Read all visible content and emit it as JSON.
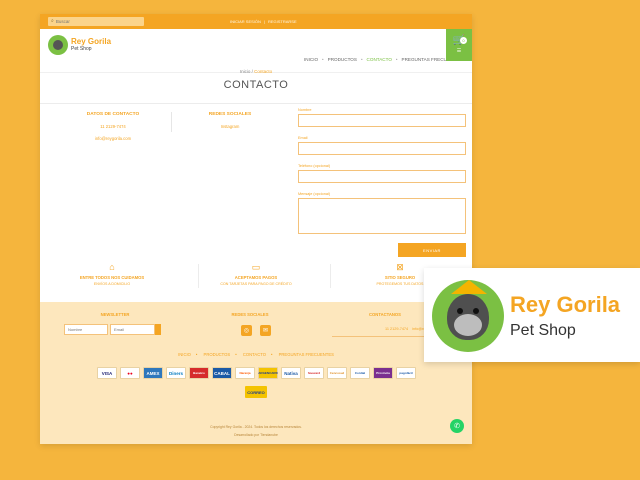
{
  "topbar": {
    "search_placeholder": "Buscar",
    "links": [
      "INICIAR SESIÓN",
      "|",
      "REGISTRARSE"
    ]
  },
  "header": {
    "brand": "Rey Gorila",
    "subtitle": "Pet Shop",
    "nav": [
      {
        "label": "INICIO",
        "active": false
      },
      {
        "label": "PRODUCTOS",
        "active": false
      },
      {
        "label": "CONTACTO",
        "active": true
      },
      {
        "label": "PREGUNTAS FRECUENTES",
        "active": false
      }
    ],
    "cart_count": "0",
    "cart_menu": "☰"
  },
  "breadcrumb": {
    "home": "Inicio",
    "sep": " / ",
    "current": "Contacto"
  },
  "title": "CONTACTO",
  "contact_info": {
    "heading": "DATOS DE CONTACTO",
    "phone": "11 2129-7474",
    "email": "info@reygorila.com"
  },
  "social_info": {
    "heading": "REDES SOCIALES",
    "link": "Instagram"
  },
  "form": {
    "name_label": "Nombre",
    "email_label": "Email",
    "phone_label": "Teléfono (opcional)",
    "message_label": "Mensaje (opcional)",
    "submit": "ENVIAR"
  },
  "features": [
    {
      "icon": "house-icon",
      "title": "ENTRE TODOS NOS CUIDAMOS",
      "sub": "ENVÍOS A DOMICILIO"
    },
    {
      "icon": "card-icon",
      "title": "ACEPTAMOS PAGOS",
      "sub": "CON TARJETAS PARA PAGO DE CRÉDITO"
    },
    {
      "icon": "lock-icon",
      "title": "SITIO SEGURO",
      "sub": "PROTEGEMOS TUS DATOS"
    }
  ],
  "footer": {
    "newsletter_heading": "NEWSLETTER",
    "newsletter_name_placeholder": "Nombre",
    "newsletter_email_placeholder": "Email",
    "social_heading": "REDES SOCIALES",
    "contact_heading": "CONTACTANOS",
    "contact_phone": "11 2129-7474",
    "contact_email": "info@reygorila.com",
    "nav": [
      "INICIO",
      "PRODUCTOS",
      "CONTACTO",
      "PREGUNTAS FRECUENTES"
    ],
    "payments_row1": [
      {
        "label": "VISA",
        "color": "#ffffff",
        "text": "#1a1f71"
      },
      {
        "label": "●●",
        "color": "#ffffff",
        "text": "#eb001b"
      },
      {
        "label": "AMEX",
        "color": "#2e77bc",
        "text": "#ffffff"
      },
      {
        "label": "Diners",
        "color": "#ffffff",
        "text": "#0079be"
      },
      {
        "label": "Banelco",
        "color": "#d62b2b",
        "text": "#ffffff"
      },
      {
        "label": "CABAL",
        "color": "#1b5aa6",
        "text": "#ffffff"
      },
      {
        "label": "Naranja",
        "color": "#ffffff",
        "text": "#ff5a00"
      },
      {
        "label": "ARGENCARD",
        "color": "#f4c300",
        "text": "#1b3b8f"
      },
      {
        "label": "Nativa",
        "color": "#ffffff",
        "text": "#1b5aa6"
      },
      {
        "label": "favacard",
        "color": "#ffffff",
        "text": "#d62b2b"
      },
      {
        "label": "Cencosud",
        "color": "#ffffff",
        "text": "#e0922b"
      },
      {
        "label": "Cordial",
        "color": "#ffffff",
        "text": "#1b5aa6"
      },
      {
        "label": "Provincia",
        "color": "#7a2f8f",
        "text": "#ffffff"
      },
      {
        "label": "pagofácil",
        "color": "#ffffff",
        "text": "#1b5aa6"
      }
    ],
    "payments_row2": [
      {
        "label": "CORREO",
        "color": "#f4c300",
        "text": "#1b3b8f"
      }
    ],
    "copyright": "Copyright Rey Gorila - 2024. Todos los derechos reservados.",
    "developed_by": "Desarrollado por Tiendanube"
  },
  "logo_card": {
    "brand": "Rey Gorila",
    "subtitle": "Pet Shop"
  }
}
